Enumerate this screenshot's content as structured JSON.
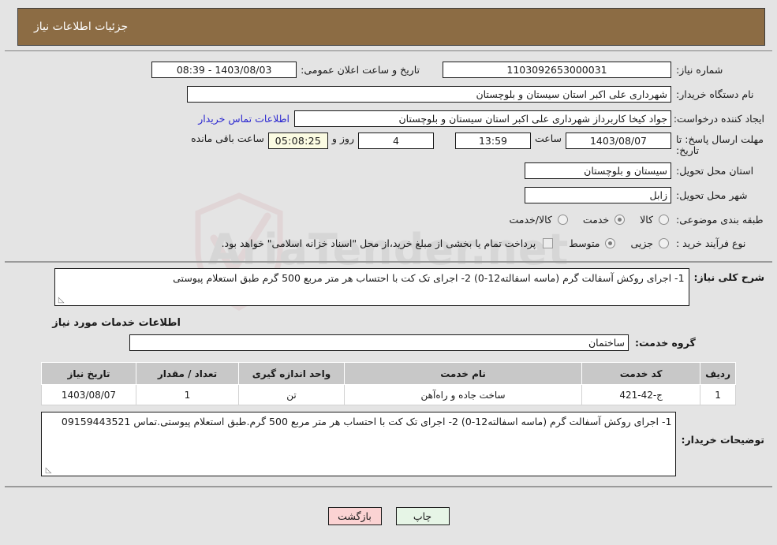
{
  "header": {
    "title": "جزئیات اطلاعات نیاز"
  },
  "watermark": {
    "text": "AriaTender.net",
    "shield_icon": "shield-icon"
  },
  "need_info": {
    "need_number": {
      "label": "شماره نیاز:",
      "value": "1103092653000031"
    },
    "announce_datetime": {
      "label": "تاریخ و ساعت اعلان عمومی:",
      "value": "1403/08/03 - 08:39"
    },
    "buyer_org": {
      "label": "نام دستگاه خریدار:",
      "value": "شهرداری علی اکبر استان سیستان و بلوچستان"
    },
    "request_creator": {
      "label": "ایجاد کننده درخواست:",
      "value": "جواد کیخا کاربرداز شهرداری علی اکبر استان سیستان و بلوچستان"
    },
    "contact_link": {
      "label": "اطلاعات تماس خریدار"
    },
    "deadline": {
      "label": "مهلت ارسال پاسخ: تا تاریخ:",
      "date": "1403/08/07",
      "time_label": "ساعت",
      "time": "13:59",
      "days": "4",
      "days_suffix": "روز و",
      "timer": "05:08:25",
      "timer_suffix": "ساعت باقی مانده"
    },
    "delivery_province": {
      "label": "استان محل تحویل:",
      "value": "سیستان و بلوچستان"
    },
    "delivery_city": {
      "label": "شهر محل تحویل:",
      "value": "زابل"
    },
    "subject_class": {
      "label": "طبقه بندی موضوعی:",
      "options": [
        {
          "label": "کالا",
          "selected": false
        },
        {
          "label": "خدمت",
          "selected": true
        },
        {
          "label": "کالا/خدمت",
          "selected": false
        }
      ]
    },
    "purchase_process": {
      "label": "نوع فرآیند خرید :",
      "options": [
        {
          "label": "جزیی",
          "selected": false
        },
        {
          "label": "متوسط",
          "selected": true
        }
      ],
      "treasury_checkbox": {
        "checked": false,
        "label": "پرداخت تمام یا بخشی از مبلغ خرید،از محل \"اسناد خزانه اسلامی\" خواهد بود."
      }
    }
  },
  "general_desc": {
    "label": "شرح کلی نیاز:",
    "value": "1- اجرای روکش آسفالت گرم (ماسه اسفالته12-0) 2- اجرای تک کت با احتساب هر متر مربع 500 گرم طبق استعلام پیوستی"
  },
  "services_section": {
    "heading": "اطلاعات خدمات مورد نیاز",
    "service_group": {
      "label": "گروه خدمت:",
      "value": "ساختمان"
    },
    "table": {
      "columns": [
        "ردیف",
        "کد خدمت",
        "نام خدمت",
        "واحد اندازه گیری",
        "تعداد / مقدار",
        "تاریخ نیاز"
      ],
      "rows": [
        {
          "index": "1",
          "service_code": "ج-42-421",
          "service_name": "ساخت جاده و راه‌آهن",
          "unit": "تن",
          "quantity": "1",
          "need_date": "1403/08/07"
        }
      ]
    }
  },
  "buyer_notes": {
    "label": "توضیحات خریدار:",
    "value": "1- اجرای روکش آسفالت گرم (ماسه اسفالته12-0) 2- اجرای تک کت با احتساب هر متر مربع 500 گرم.طبق استعلام پیوستی.تماس 09159443521"
  },
  "footer": {
    "print_label": "چاپ",
    "back_label": "بازگشت"
  },
  "colors": {
    "header_brown": "#8c6c44",
    "page_bg": "#e4e4e4",
    "link_blue": "#2b27d0",
    "timer_bg": "#fbfbe2",
    "btn_print_bg": "#e6f5e6",
    "btn_back_bg": "#fbd3d3"
  }
}
